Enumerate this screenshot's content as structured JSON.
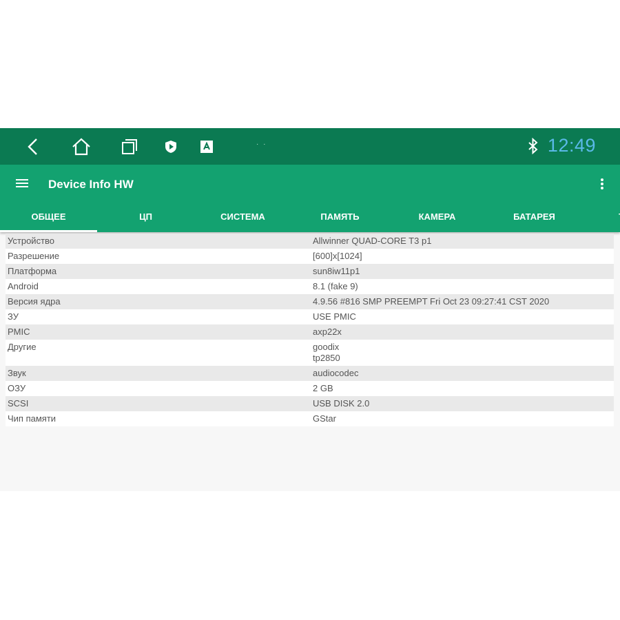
{
  "status_bar": {
    "time": "12:49",
    "dots": "· ·",
    "icons": [
      "back-icon",
      "home-icon",
      "recents-icon",
      "shield-app-icon",
      "keyboard-a-icon",
      "bluetooth-icon"
    ],
    "time_color": "#5ab9e8",
    "background": "#0b7a52"
  },
  "app_bar": {
    "title": "Device Info HW",
    "background": "#13a270"
  },
  "tabs": [
    {
      "label": "ОБЩЕЕ",
      "active": true
    },
    {
      "label": "ЦП",
      "active": false
    },
    {
      "label": "СИСТЕМА",
      "active": false
    },
    {
      "label": "ПАМЯТЬ",
      "active": false
    },
    {
      "label": "КАМЕРА",
      "active": false
    },
    {
      "label": "БАТАРЕЯ",
      "active": false
    },
    {
      "label": "ТЕМП",
      "active": false
    }
  ],
  "rows": [
    {
      "key": "Устройство",
      "value": "Allwinner QUAD-CORE T3 p1"
    },
    {
      "key": "Разрешение",
      "value": "[600]x[1024]"
    },
    {
      "key": "Платформа",
      "value": "sun8iw11p1"
    },
    {
      "key": "Android",
      "value": "8.1 (fake 9)"
    },
    {
      "key": "Версия ядра",
      "value": "4.9.56 #816 SMP PREEMPT Fri Oct 23 09:27:41 CST 2020"
    },
    {
      "key": "ЗУ",
      "value": "USE PMIC"
    },
    {
      "key": "PMIC",
      "value": "axp22x"
    },
    {
      "key": "Другие",
      "value": "goodix\ntp2850"
    },
    {
      "key": "Звук",
      "value": "audiocodec"
    },
    {
      "key": "ОЗУ",
      "value": "2 GB"
    },
    {
      "key": "SCSI",
      "value": "USB DISK 2.0"
    },
    {
      "key": "Чип памяти",
      "value": "GStar"
    }
  ]
}
